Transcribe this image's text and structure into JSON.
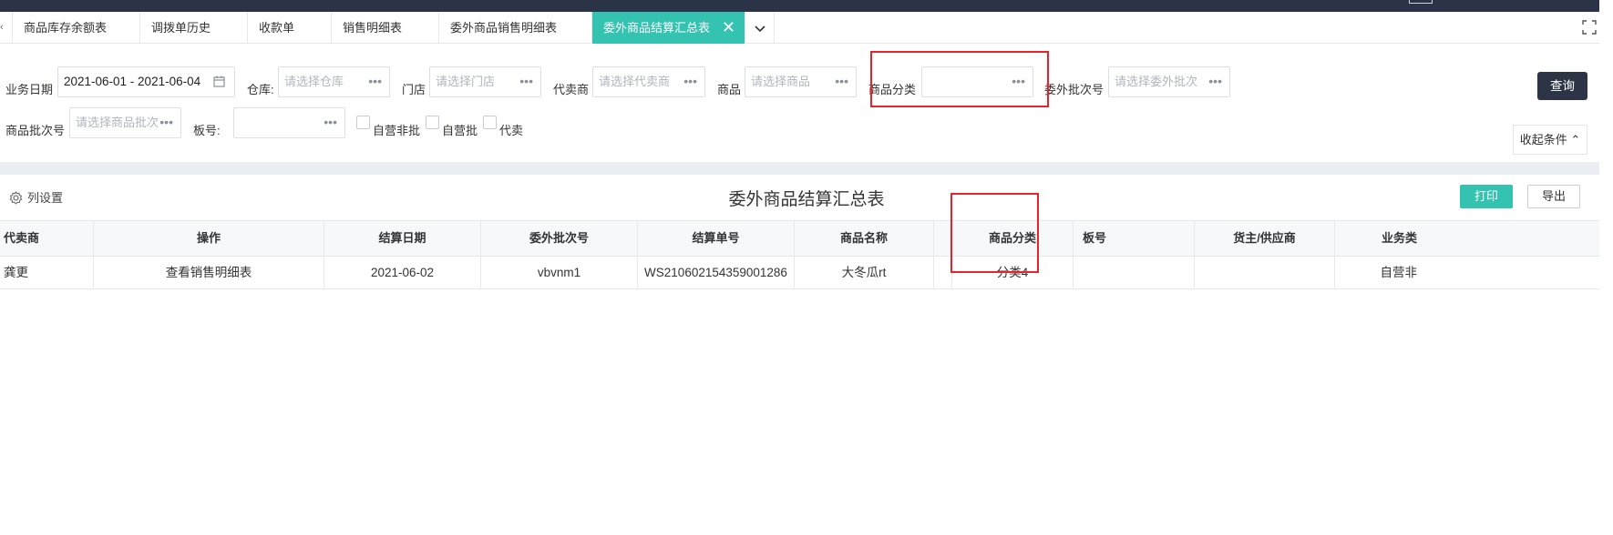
{
  "tabs": [
    {
      "label": "商品库存余额表"
    },
    {
      "label": "调拨单历史"
    },
    {
      "label": "收款单"
    },
    {
      "label": "销售明细表"
    },
    {
      "label": "委外商品销售明细表"
    },
    {
      "label": "委外商品结算汇总表",
      "active": true
    }
  ],
  "filters": {
    "date_label": "业务日期",
    "date_value": "2021-06-01 - 2021-06-04",
    "warehouse_label": "仓库:",
    "warehouse_placeholder": "请选择仓库",
    "store_label": "门店",
    "store_placeholder": "请选择门店",
    "agent_label": "代卖商",
    "agent_placeholder": "请选择代卖商",
    "product_label": "商品",
    "product_placeholder": "请选择商品",
    "category_label": "商品分类",
    "category_value": "",
    "batch_label": "委外批次号",
    "batch_placeholder": "请选择委外批次",
    "product_batch_label": "商品批次号",
    "product_batch_placeholder": "请选择商品批次",
    "board_label": "板号:",
    "checkbox_self_nonbatch": "自营非批",
    "checkbox_self_batch": "自营批",
    "checkbox_consign": "代卖",
    "query_button": "查询",
    "collapse_button": "收起条件 ⌃"
  },
  "report": {
    "title": "委外商品结算汇总表",
    "column_settings": "列设置",
    "print_button": "打印",
    "export_button": "导出"
  },
  "table": {
    "headers": [
      "代卖商",
      "操作",
      "结算日期",
      "委外批次号",
      "结算单号",
      "商品名称",
      "",
      "商品分类",
      "板号",
      "货主/供应商",
      "业务类"
    ],
    "rows": [
      [
        "龚更",
        "查看销售明细表",
        "2021-06-02",
        "vbvnm1",
        "WS210602154359001286",
        "大冬瓜rt",
        "",
        "分类4",
        "",
        "",
        "自营非"
      ]
    ]
  },
  "colors": {
    "accent": "#34c3b0",
    "dark_button": "#2d3446",
    "highlight_box": "#e8232b"
  }
}
